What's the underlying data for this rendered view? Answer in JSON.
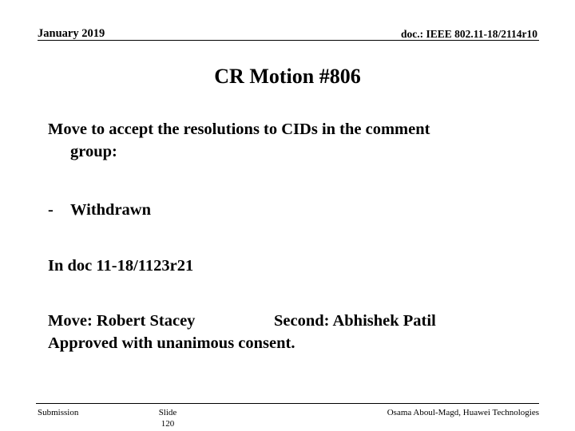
{
  "header": {
    "date": "January 2019",
    "doc_reference": "doc.: IEEE 802.11-18/2114r10"
  },
  "title": "CR Motion #806",
  "body": {
    "motion_line1": "Move to accept the  resolutions to CIDs in the comment",
    "motion_line2": "group:",
    "bullet_marker": "-",
    "bullet_text": "Withdrawn",
    "doc_line": "In doc 11-18/1123r21",
    "mover_label": "Move: Robert Stacey",
    "seconder_label": "Second: Abhishek Patil",
    "result_line": "Approved with unanimous consent."
  },
  "footer": {
    "left": "Submission",
    "slide_word": "Slide",
    "slide_number": "120",
    "right": "Osama Aboul-Magd, Huawei Technologies"
  },
  "colors": {
    "text": "#000000",
    "background": "#ffffff",
    "rule": "#000000"
  }
}
